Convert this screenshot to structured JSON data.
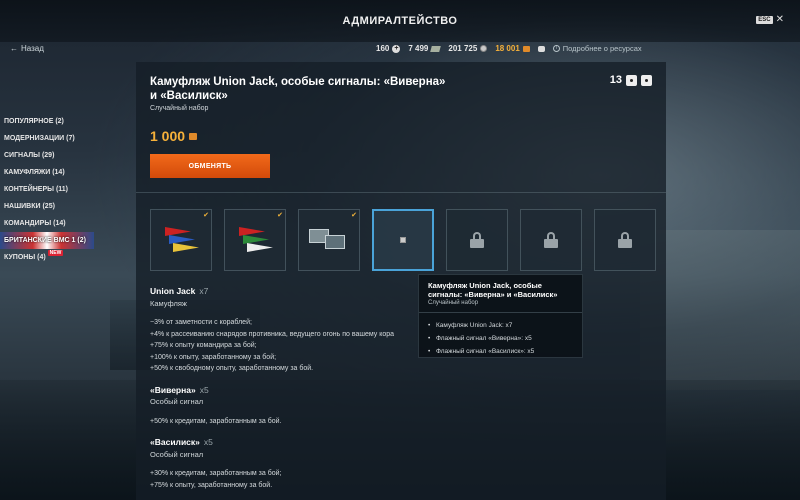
{
  "window": {
    "title": "АДМИРАЛТЕЙСТВО",
    "esc_key": "ESC",
    "close_glyph": "✕"
  },
  "nav": {
    "back_label": "Назад",
    "back_glyph": "←"
  },
  "resources": {
    "items": [
      {
        "value": "160",
        "icon": "plus-circle-icon"
      },
      {
        "value": "7 499",
        "icon": "bill-icon"
      },
      {
        "value": "201 725",
        "icon": "silver-coin-icon"
      },
      {
        "value": "18 001",
        "icon": "gold-icon",
        "color": "#f6b13a"
      },
      {
        "value": "",
        "icon": "cylinder-icon"
      }
    ],
    "info_label": "Подробнее о ресурсах",
    "info_glyph": "i"
  },
  "sidebar": {
    "items": [
      {
        "label": "ПОПУЛЯРНОЕ (2)"
      },
      {
        "label": "МОДЕРНИЗАЦИИ (7)"
      },
      {
        "label": "СИГНАЛЫ (29)"
      },
      {
        "label": "КАМУФЛЯЖИ (14)"
      },
      {
        "label": "КОНТЕЙНЕРЫ (11)"
      },
      {
        "label": "НАШИВКИ (25)"
      },
      {
        "label": "КОМАНДИРЫ (14)"
      },
      {
        "label": "БРИТАНСКИЕ ВМС 1 (2)",
        "active": true
      },
      {
        "label": "КУПОНЫ (4)",
        "badge": "NEW"
      }
    ]
  },
  "offer": {
    "title": "Камуфляж Union Jack, особые сигналы: «Виверна» и «Василиск»",
    "subtitle": "Случайный набор",
    "price": "1 000",
    "exchange_label": "ОБМЕНЯТЬ",
    "count": "13"
  },
  "slots": [
    {
      "kind": "flags",
      "checked": true
    },
    {
      "kind": "flags-green",
      "checked": true
    },
    {
      "kind": "crates",
      "checked": true
    },
    {
      "kind": "image",
      "selected": true
    },
    {
      "kind": "locked"
    },
    {
      "kind": "locked"
    },
    {
      "kind": "locked"
    }
  ],
  "details": [
    {
      "name": "Union Jack",
      "qty": "x7",
      "type": "Камуфляж",
      "lines": [
        "−3% от заметности с кораблей;",
        "+4% к рассеиванию снарядов противника, ведущего огонь по вашему кора",
        "+75% к опыту командира за бой;",
        "+100% к опыту, заработанному за бой;",
        "+50% к свободному опыту, заработанному за бой."
      ]
    },
    {
      "name": "«Виверна»",
      "qty": "x5",
      "type": "Особый сигнал",
      "lines": [
        "+50% к кредитам, заработанным за бой."
      ]
    },
    {
      "name": "«Василиск»",
      "qty": "x5",
      "type": "Особый сигнал",
      "lines": [
        "+30% к кредитам, заработанным за бой;",
        "+75% к опыту, заработанному за бой."
      ]
    }
  ],
  "tooltip": {
    "title": "Камуфляж Union Jack, особые сигналы: «Виверна» и «Василиск»",
    "subtitle": "Случайный набор",
    "items": [
      "Камуфляж Union Jack: x7",
      "Флажный сигнал «Виверна»: x5",
      "Флажный сигнал «Василиск»: x5"
    ]
  },
  "colors": {
    "accent_orange": "#f26a1a",
    "gold": "#f6b13a",
    "selected_border": "#4aa3d8"
  }
}
